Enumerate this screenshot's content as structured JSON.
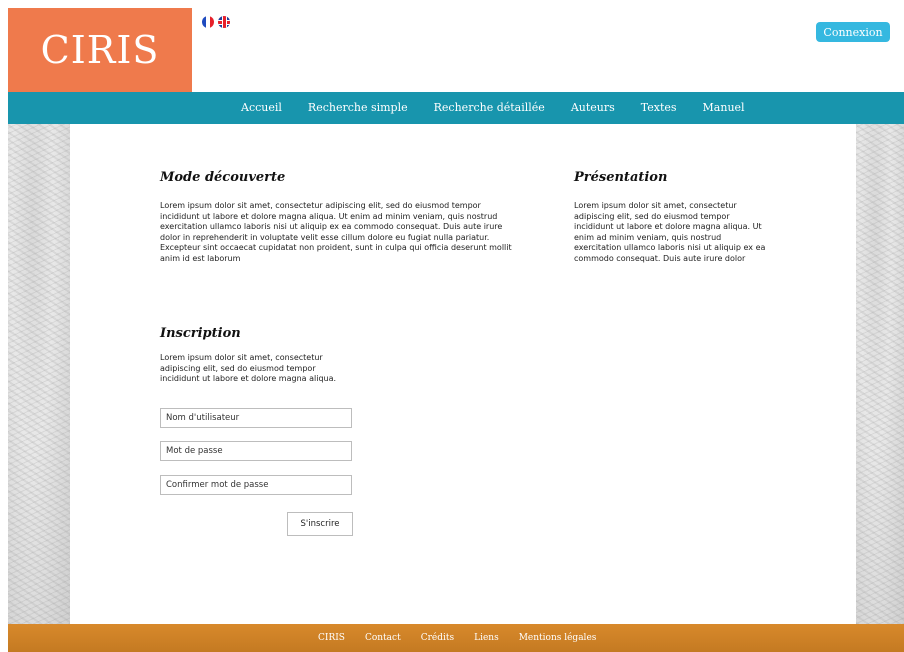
{
  "header": {
    "logo_text": "CIRIS",
    "login_label": "Connexion",
    "flags": [
      "fr-flag-icon",
      "uk-flag-icon"
    ]
  },
  "nav": {
    "items": [
      {
        "label": "Accueil"
      },
      {
        "label": "Recherche simple"
      },
      {
        "label": "Recherche détaillée"
      },
      {
        "label": "Auteurs"
      },
      {
        "label": "Textes"
      },
      {
        "label": "Manuel"
      }
    ]
  },
  "main": {
    "discovery": {
      "title": "Mode découverte",
      "text": "Lorem ipsum dolor sit amet, consectetur adipiscing elit, sed do eiusmod tempor incididunt ut labore et dolore magna aliqua. Ut enim ad minim veniam, quis nostrud exercitation ullamco laboris nisi ut aliquip ex ea commodo consequat. Duis aute irure dolor in reprehenderit in voluptate velit esse cillum dolore eu fugiat nulla pariatur. Excepteur sint occaecat cupidatat non proident, sunt in culpa qui officia deserunt mollit anim id est laborum"
    },
    "presentation": {
      "title": "Présentation",
      "text": "Lorem ipsum dolor sit amet, consectetur adipiscing elit, sed do eiusmod tempor incididunt ut labore et dolore magna aliqua. Ut enim ad minim veniam, quis nostrud exercitation ullamco laboris nisi ut aliquip ex ea commodo consequat. Duis aute irure dolor"
    },
    "signup": {
      "title": "Inscription",
      "text": "Lorem ipsum dolor sit amet, consectetur adipiscing elit, sed do eiusmod tempor incididunt ut labore et dolore magna aliqua.",
      "username_placeholder": "Nom d'utilisateur",
      "password_placeholder": "Mot de passe",
      "confirm_placeholder": "Confirmer mot de passe",
      "submit_label": "S'inscrire"
    }
  },
  "footer": {
    "items": [
      {
        "label": "CIRIS"
      },
      {
        "label": "Contact"
      },
      {
        "label": "Crédits"
      },
      {
        "label": "Liens"
      },
      {
        "label": "Mentions légales"
      }
    ]
  },
  "colors": {
    "logo_bg": "#ef7a4c",
    "nav_bg": "#1895ad",
    "login_btn": "#35b8e0",
    "footer_bg": "#c47a22"
  }
}
